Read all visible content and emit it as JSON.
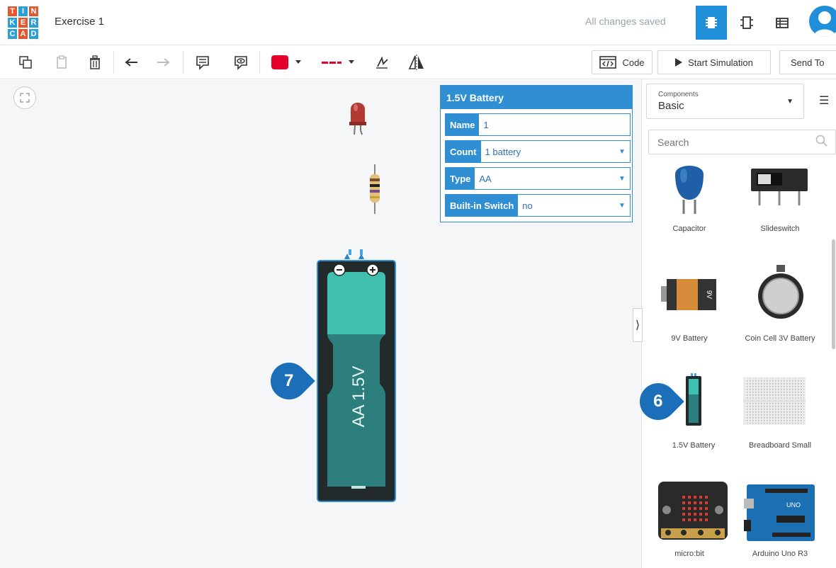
{
  "header": {
    "logo_letters": [
      "T",
      "I",
      "N",
      "K",
      "E",
      "R",
      "C",
      "A",
      "D"
    ],
    "logo_colors": [
      "#e4572e",
      "#2c9fd8",
      "#e4572e",
      "#2c9fd8",
      "#e4572e",
      "#2c9fd8",
      "#2c9fd8",
      "#e4572e",
      "#2c9fd8"
    ],
    "title": "Exercise 1",
    "status": "All changes saved",
    "view_buttons": [
      "circuit-view-icon",
      "schematic-view-icon",
      "component-list-icon"
    ]
  },
  "toolbar": {
    "tools": [
      "copy-icon",
      "paste-icon",
      "delete-icon",
      "undo-icon",
      "redo-icon",
      "notes-icon",
      "notes-visibility-icon",
      "color-picker",
      "wire-type-picker",
      "rotate-icon",
      "flip-icon"
    ],
    "color_value": "#e4002b",
    "code_label": "Code",
    "simulate_label": "Start Simulation",
    "send_label": "Send To"
  },
  "inspector": {
    "title": "1.5V Battery",
    "fields": [
      {
        "label": "Name",
        "value": "1"
      },
      {
        "label": "Count",
        "value": "1 battery"
      },
      {
        "label": "Type",
        "value": "AA"
      },
      {
        "label": "Built-in Switch",
        "value": "no"
      }
    ]
  },
  "canvas": {
    "battery_label": "AA 1.5V",
    "callout_battery": "7",
    "callout_panel": "6"
  },
  "panel": {
    "components_small": "Components",
    "components_value": "Basic",
    "search_placeholder": "Search",
    "items": [
      {
        "label": "Capacitor"
      },
      {
        "label": "Slideswitch"
      },
      {
        "label": "9V Battery"
      },
      {
        "label": "Coin Cell 3V Battery"
      },
      {
        "label": "1.5V Battery"
      },
      {
        "label": "Breadboard Small"
      },
      {
        "label": "micro:bit"
      },
      {
        "label": "Arduino Uno R3"
      }
    ]
  }
}
